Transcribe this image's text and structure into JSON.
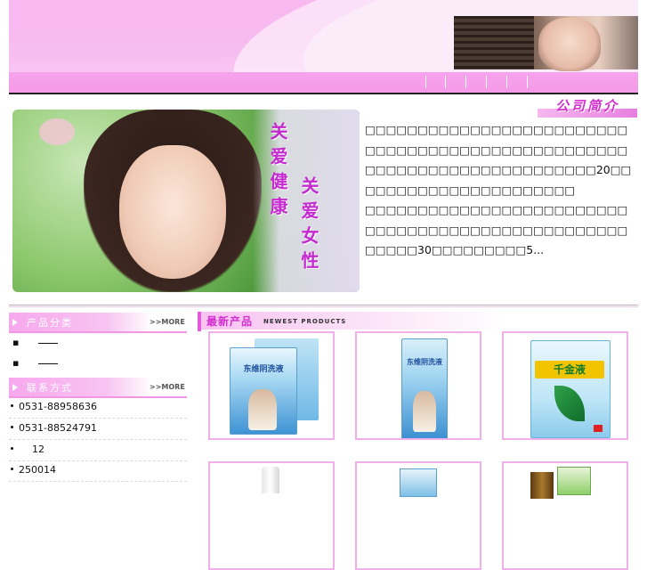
{
  "about": {
    "title": "公司简介",
    "paragraph1": "□□□□□□□□□□□□□□□□□□□□□□□□□□□□□□□□□□□□□□□□□□□□□□□□□□□□□□□□□□□□□□□□□□□□□□□□20□□□□□□□□□□□□□□□□□□□□□□",
    "paragraph2": "□□□□□□□□□□□□□□□□□□□□□□□□□□□□□□□□□□□□□□□□□□□□□□□□□□□□□□□30□□□□□□□□□5..."
  },
  "banner": {
    "slogan_col1": "关爱健康",
    "slogan_col2": "关爱女性"
  },
  "sidebar": {
    "categories_title": "产品分类",
    "categories_more": ">>MORE",
    "contact_title": "联系方式",
    "contact_more": ">>MORE",
    "contacts": [
      "0531-88958636",
      "0531-88524791",
      "12",
      "250014"
    ]
  },
  "products": {
    "title_cn": "最新产品",
    "title_en": "NEWEST PRODUCTS",
    "items": [
      {
        "box_text": "东维阴洗液"
      },
      {
        "box_text": "东维阴洗液"
      },
      {
        "box_text": "千金液"
      }
    ]
  },
  "colors": {
    "accent": "#e35bd8",
    "header_pink": "#f7bcf0",
    "title_magenta": "#d32fcf"
  }
}
